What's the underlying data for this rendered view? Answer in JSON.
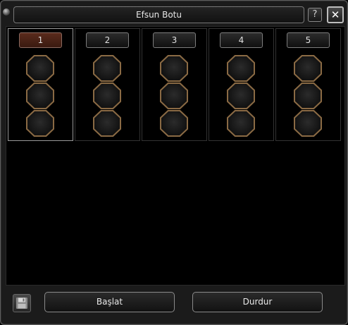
{
  "window": {
    "title": "Efsun Botu",
    "help_label": "?",
    "close_label": "✕"
  },
  "slots": [
    {
      "label": "1",
      "active": true
    },
    {
      "label": "2",
      "active": false
    },
    {
      "label": "3",
      "active": false
    },
    {
      "label": "4",
      "active": false
    },
    {
      "label": "5",
      "active": false
    }
  ],
  "footer": {
    "save_icon": "floppy-disk-icon",
    "start_label": "Başlat",
    "stop_label": "Durdur"
  }
}
